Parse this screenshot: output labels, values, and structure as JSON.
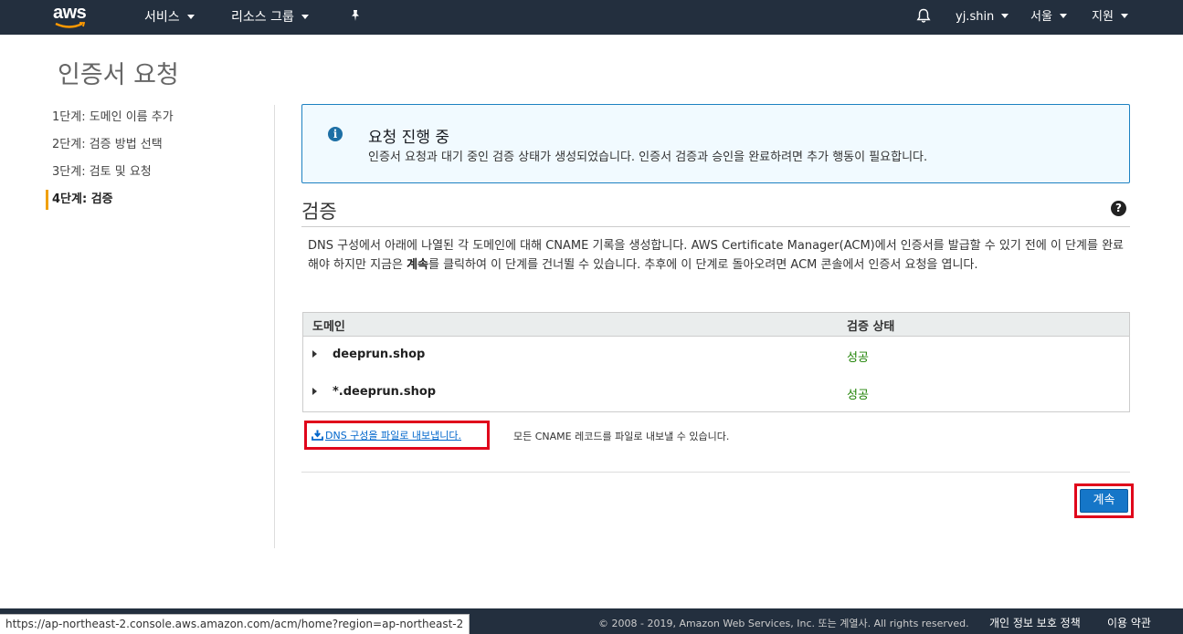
{
  "nav": {
    "logo": "aws",
    "services": "서비스",
    "resource_groups": "리소스 그룹",
    "pin_icon": "pin-icon",
    "bell_icon": "bell-icon",
    "user": "yj.shin",
    "region": "서울",
    "support": "지원"
  },
  "page": {
    "title": "인증서 요청"
  },
  "steps": [
    {
      "label": "1단계: 도메인 이름 추가"
    },
    {
      "label": "2단계: 검증 방법 선택"
    },
    {
      "label": "3단계: 검토 및 요청"
    },
    {
      "label": "4단계: 검증"
    }
  ],
  "info": {
    "icon": "info-icon",
    "title": "요청 진행 중",
    "text": "인증서 요청과 대기 중인 검증 상태가 생성되었습니다. 인증서 검증과 승인을 완료하려면 추가 행동이 필요합니다."
  },
  "verification": {
    "title": "검증",
    "help_icon": "help-icon",
    "desc_part1": "DNS 구성에서 아래에 나열된 각 도메인에 대해 CNAME 기록을 생성합니다. AWS Certificate Manager(ACM)에서 인증서를 발급할 수 있기 전에 이 단계를 완료해야 하지만 지금은 ",
    "desc_bold": "계속",
    "desc_part2": "를 클릭하여 이 단계를 건너뛸 수 있습니다. 추후에 이 단계로 돌아오려면 ACM 콘솔에서 인증서 요청을 엽니다.",
    "table": {
      "col_domain": "도메인",
      "col_status": "검증 상태",
      "rows": [
        {
          "domain": "deeprun.shop",
          "status": "성공"
        },
        {
          "domain": "*.deeprun.shop",
          "status": "성공"
        }
      ]
    },
    "export_link": "DNS 구성을 파일로 내보냅니다.",
    "export_icon": "download-icon",
    "export_note": "모든 CNAME 레코드를 파일로 내보낼 수 있습니다.",
    "continue": "계속",
    "status_color": "#1d8102"
  },
  "footer": {
    "copyright": "© 2008 - 2019, Amazon Web Services, Inc. 또는 계열사. All rights reserved.",
    "privacy": "개인 정보 보호 정책",
    "terms": "이용 약관"
  },
  "statusbar": {
    "url": "https://ap-northeast-2.console.aws.amazon.com/acm/home?region=ap-northeast-2"
  },
  "colors": {
    "nav_bg": "#232f3e",
    "accent": "#1576c8",
    "highlight": "#e0051b"
  }
}
